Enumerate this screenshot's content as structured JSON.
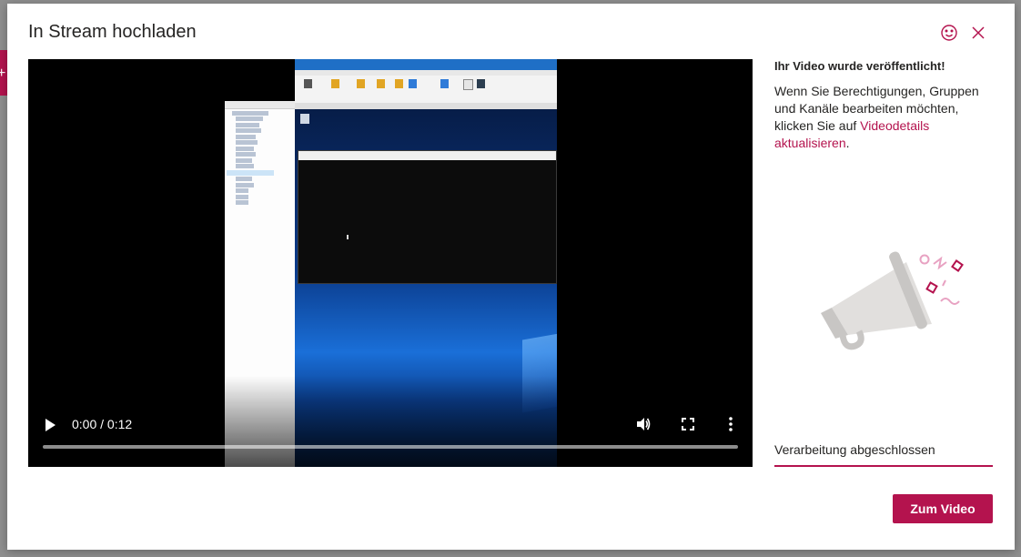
{
  "dialog": {
    "title": "In Stream hochladen"
  },
  "icons": {
    "feedback": "smiley-icon",
    "close": "close-icon",
    "play": "play-icon",
    "volume": "volume-icon",
    "fullscreen": "fullscreen-icon",
    "more": "more-options-icon",
    "illustration": "megaphone-icon"
  },
  "video": {
    "time": "0:00 / 0:12",
    "progress": 0
  },
  "side": {
    "heading": "Ihr Video wurde veröffentlicht!",
    "text_before": "Wenn Sie Berechtigungen, Gruppen und Kanäle bearbeiten möchten, klicken Sie auf ",
    "link": "Videodetails aktualisieren",
    "text_after": "."
  },
  "status": {
    "label": "Verarbeitung abgeschlossen"
  },
  "actions": {
    "primary_label": "Zum Video"
  },
  "colors": {
    "accent": "#b4134e",
    "text": "#252423"
  }
}
